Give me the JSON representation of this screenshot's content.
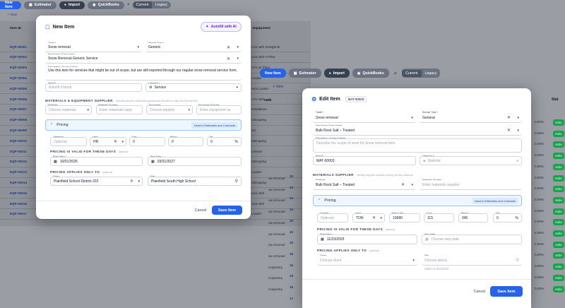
{
  "bg": {
    "toolbar": {
      "new_item": "New Item",
      "estimator": "Estimator",
      "import": "Import",
      "quickbooks": "QuickBooks",
      "current": "Current",
      "legacy": "Legacy"
    },
    "view_label": "View",
    "col_item_id": "Item ID",
    "ids": [
      "EQP-00001",
      "EQP-00002",
      "EQP-00003",
      "EQP-00004",
      "EQP-00005",
      "EQP-00006",
      "EQP-00007",
      "EQP-00008",
      "EQP-00009",
      "EQP-00010",
      "EQP-00011",
      "EQP-00012",
      "EQP-00013",
      "EQP-00014",
      "EQP-00015",
      "EQP-00016",
      "EQP-00017"
    ],
    "names": [
      "ruck with Straight-B",
      "ruck with V-Plow",
      "ATV w/ Plow",
      "Loader",
      "ruck Loader",
      "ATV with",
      "installation",
      "ndscaping",
      "ent",
      "ndscaping",
      "Limited",
      "ndscaping",
      "Loader",
      "ndscaping",
      "ruck with",
      "ruck with",
      "Loader"
    ],
    "right_names": [
      "ow removal",
      "ow removal",
      "ow removal",
      "ow removal",
      "ow removal",
      "ow removal",
      "ow removal",
      "ow removal",
      "Carpentry",
      "Carpentry",
      "Carpentry"
    ],
    "right_nums": [
      "33",
      "33",
      "34",
      "32",
      "32",
      "32",
      "32",
      "32",
      "32",
      "15",
      "15",
      "17"
    ],
    "pcts": [
      "0.00%",
      "0.00%",
      "0.00%",
      "0.00%",
      "0.00%",
      "0.00%",
      "0.00%",
      "0.00%",
      "0.00%",
      "0.00%",
      "0.00%",
      "0.00%",
      "0.00%",
      "0.00%",
      "0.00%",
      "0.00%"
    ],
    "act": "Activ",
    "col_equipment": "Equipment",
    "col_stat": "Stat"
  },
  "mid_toolbar": {
    "new_item": "New Item",
    "estimator": "Estimator",
    "import": "Import",
    "quickbooks": "QuickBooks",
    "current": "Current",
    "legacy": "Legacy",
    "view": "View",
    "grade": "rade"
  },
  "modal1": {
    "title": "New Item",
    "autofill": "Autofill with AI",
    "trade_label": "Trade *",
    "trade": "Snow removal",
    "service_type_label": "Service Type *",
    "service_type": "Generic",
    "item_name_label": "Item Name / Form Name",
    "item_name": "Snow Removal Generic Service",
    "desc_label": "Description / Scope of Work",
    "desc": "Use this item for services that might be out of scope, but are still reported through our regular snow removal service form.",
    "item_id_label": "Item ID",
    "item_id_ph": "Autofill if blank",
    "category_label": "Category *",
    "category": "Service",
    "mat_section": "Materials & Equipment Supplier",
    "mat_sub": "Specify specific materials/equipments needed or used for this service",
    "materials_label": "Materials",
    "materials_ph": "Choose materials",
    "mat_supplier_label": "Materials Supplier",
    "mat_supplier_ph": "Enter materials supp",
    "equipment_label": "Equipment",
    "equipment_ph": "Choose equipm",
    "eq_supplier_label": "Equipment Supplier",
    "eq_supplier_ph": "Enter equipment su",
    "pricing": "Pricing",
    "used_badge": "Used in Estimates and Contracts",
    "minimum_label": "Minimum",
    "minimum_ph": "Optional",
    "unit_label": "Unit *",
    "unit": "HR",
    "cost_label": "Cost",
    "cost": "0",
    "price_label": "Price *",
    "price": "0",
    "tax_label": "Tax",
    "tax": "0",
    "pct": "%",
    "valid_section": "Pricing is valid for these days",
    "valid_sub": "optional",
    "start_label": "Start Date *",
    "start": "10/01/2026",
    "stop_label": "Stop Date",
    "stop": "03/31/2027",
    "applies_section": "Pricing applies only to",
    "applies_sub": "optional",
    "client_label": "Client",
    "client": "Plainfield School District 202",
    "site_label": "Site",
    "site": "Plainfield South High School",
    "cancel": "Cancel",
    "save": "Save Item"
  },
  "modal2": {
    "title": "Edit Item",
    "item_badge": "MAT-00003",
    "trade_label": "Trade *",
    "trade": "Snow removal",
    "service_type_label": "Service Type *",
    "service_type": "General",
    "item_name_label": "Item Name / Form Name",
    "item_name": "Bulk Rock Salt – Treated",
    "desc_label": "Description / Scope of Work",
    "desc_ph": "Describe the scope of work for Snow removal item",
    "item_id_label": "Item ID",
    "item_id": "MAT-00003",
    "category_label": "Category *",
    "category_ph": "Material",
    "mat_section": "Materials Supplier",
    "mat_sub": "Identify supplier specific pricing for this material",
    "materials_label": "Materials",
    "materials": "Bulk Rock Salt – Treated",
    "mat_supplier_label": "Materials Supplier",
    "mat_supplier_ph": "Enter materials supplier",
    "pricing": "Pricing",
    "used_badge": "Used in Estimates and Contracts",
    "qty_label": "Quantity",
    "qty_ph": "Optional",
    "unit_label": "Unit *",
    "unit": "TON",
    "split_label": "Split / Unit",
    "split": "10680",
    "cost_label": "Cost",
    "cost": "115",
    "price_label": "Price *",
    "price": "345",
    "tax_label": "Tax",
    "tax": "0",
    "pct": "%",
    "valid_section": "Pricing is valid for these days",
    "valid_sub": "optional",
    "start_label": "Start Date *",
    "start": "11/23/2025",
    "stop_label": "Stop Date",
    "stop_ph": "Choose stop date",
    "applies_section": "Pricing applies only to",
    "applies_sub": "optional",
    "client_label": "Client",
    "client_ph": "Choose client",
    "site_label": "Site",
    "site_ph": "Choose site(s)",
    "site_hint": "Select a client first",
    "cancel": "Cancel",
    "save": "Save Item"
  }
}
